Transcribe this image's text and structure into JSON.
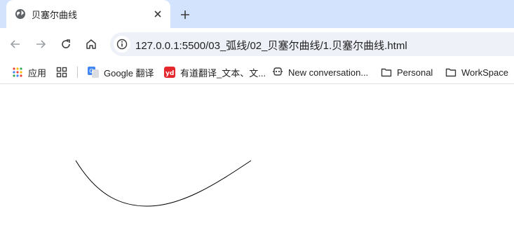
{
  "tab": {
    "title": "贝塞尔曲线"
  },
  "toolbar": {
    "url": "127.0.0.1:5500/03_弧线/02_贝塞尔曲线/1.贝塞尔曲线.html"
  },
  "bookmarks": [
    {
      "label": "应用",
      "icon": "apps-grid-icon"
    },
    {
      "label": "",
      "icon": "grid-icon"
    },
    {
      "label": "Google 翻译",
      "icon": "google-translate-icon"
    },
    {
      "label": "有道翻译_文本、文...",
      "icon": "youdao-icon"
    },
    {
      "label": "New conversation...",
      "icon": "copilot-icon"
    },
    {
      "label": "Personal",
      "icon": "folder-icon"
    },
    {
      "label": "WorkSpace",
      "icon": "folder-icon"
    }
  ],
  "colors": {
    "tabstrip": "#d3e3fd",
    "omnibox": "#eef1f8",
    "curve": "#000000"
  }
}
